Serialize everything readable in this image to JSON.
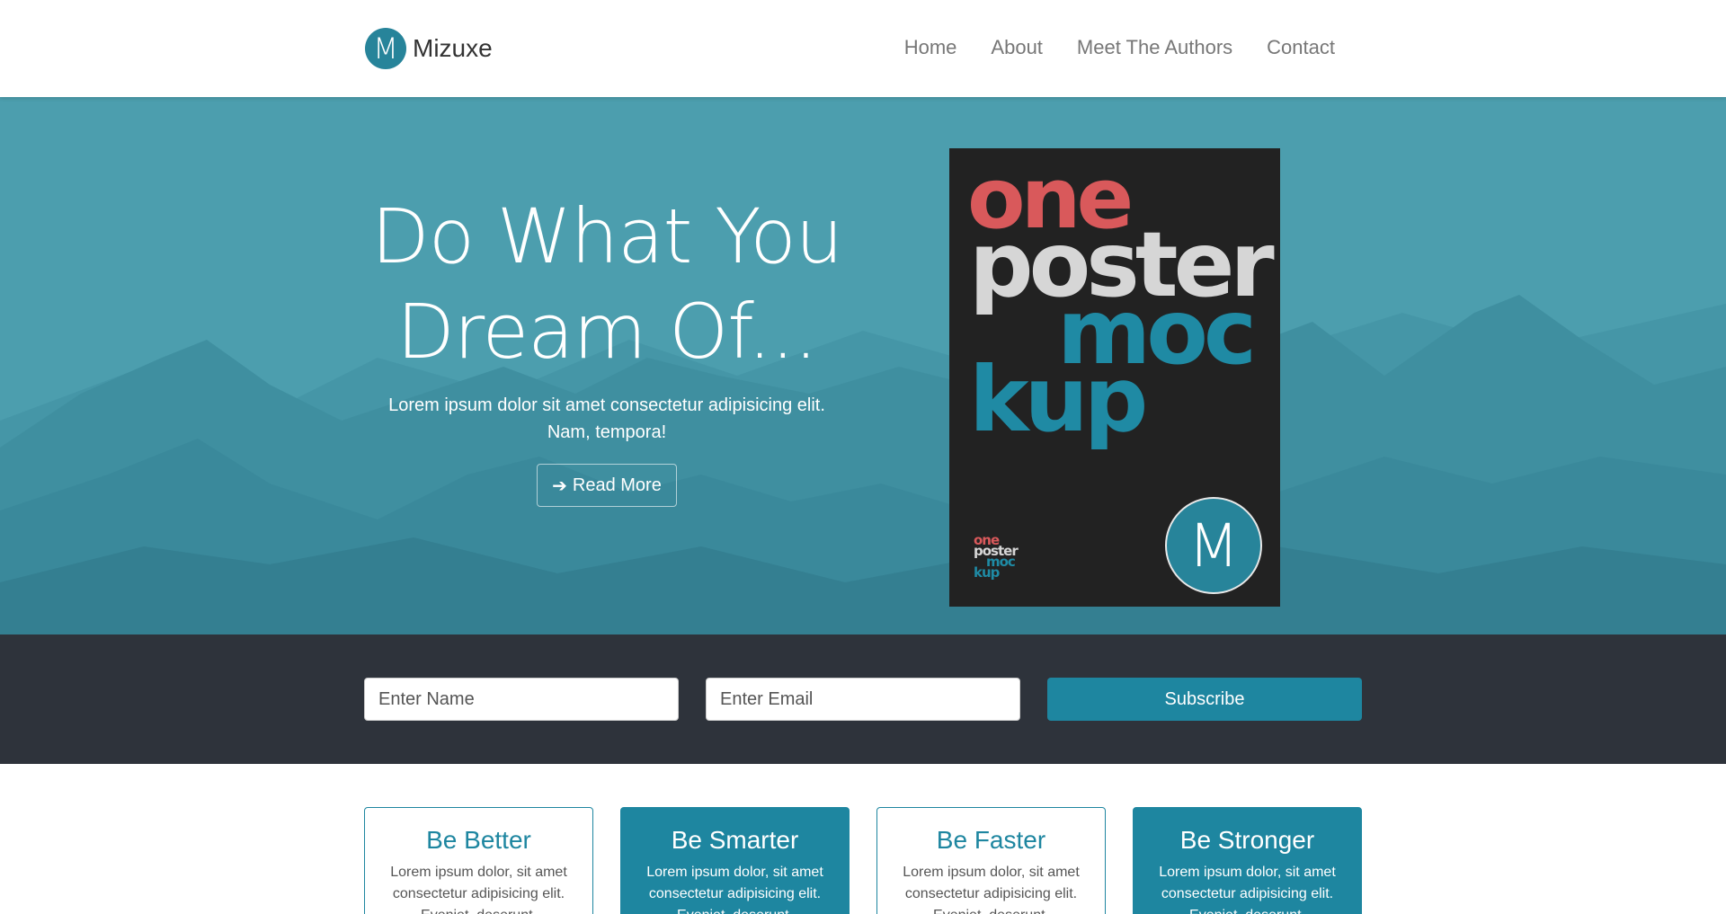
{
  "brand": {
    "logo_letter": "M",
    "name": "Mizuxe"
  },
  "nav": {
    "items": [
      "Home",
      "About",
      "Meet The Authors",
      "Contact"
    ]
  },
  "hero": {
    "title_line1": "Do What You",
    "title_line2": "Dream Of...",
    "subtitle": "Lorem ipsum dolor sit amet consectetur adipisicing elit. Nam, tempora!",
    "button_label": "Read More",
    "button_icon": "arrow-right-icon"
  },
  "poster": {
    "words": [
      "one",
      "poster",
      "moc",
      "kup"
    ],
    "small_words": [
      "one",
      "poster",
      "moc",
      "kup"
    ],
    "logo_letter": "M",
    "colors": {
      "red": "#d9595b",
      "grey": "#d6d6d6",
      "teal": "#1f8aa4",
      "bg": "#222222"
    }
  },
  "subscribe": {
    "name_placeholder": "Enter Name",
    "email_placeholder": "Enter Email",
    "button_label": "Subscribe"
  },
  "features": [
    {
      "title": "Be Better",
      "text": "Lorem ipsum dolor, sit amet consectetur adipisicing elit. Eveniet, deserunt.",
      "style": "light"
    },
    {
      "title": "Be Smarter",
      "text": "Lorem ipsum dolor, sit amet consectetur adipisicing elit. Eveniet, deserunt.",
      "style": "dark"
    },
    {
      "title": "Be Faster",
      "text": "Lorem ipsum dolor, sit amet consectetur adipisicing elit. Eveniet, deserunt.",
      "style": "light"
    },
    {
      "title": "Be Stronger",
      "text": "Lorem ipsum dolor, sit amet consectetur adipisicing elit. Eveniet, deserunt.",
      "style": "dark"
    }
  ],
  "theme": {
    "primary": "#1e86a0",
    "hero_bg": "#4c9eae",
    "dark_bg": "#2e333b"
  }
}
